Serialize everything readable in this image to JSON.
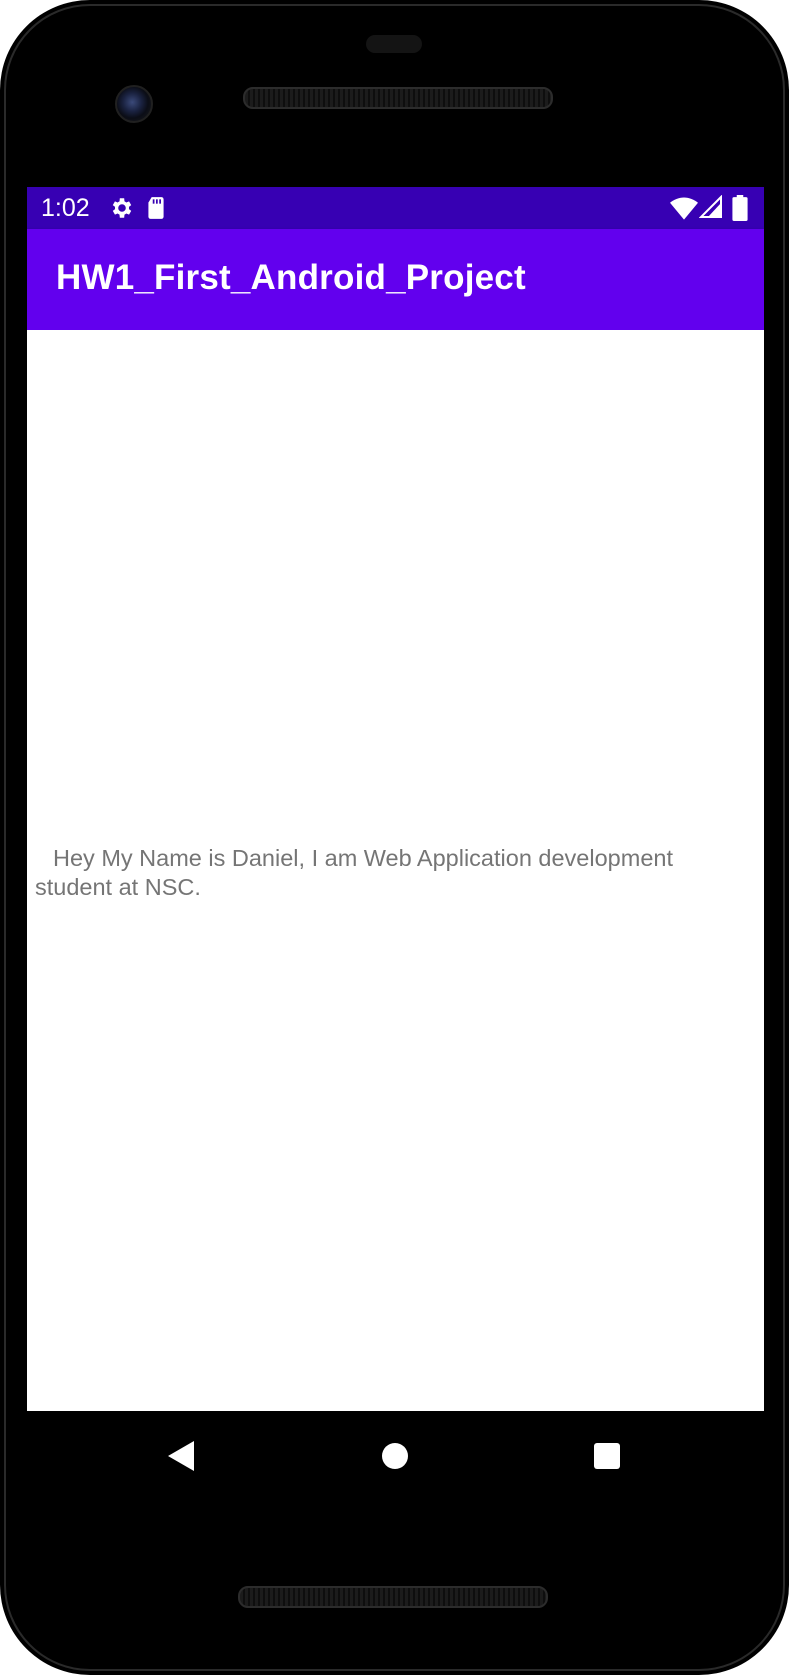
{
  "status_bar": {
    "time": "1:02",
    "icons": [
      "gear-icon",
      "sd-card-icon",
      "wifi-icon",
      "signal-icon",
      "battery-icon"
    ]
  },
  "app_bar": {
    "title": "HW1_First_Android_Project"
  },
  "content": {
    "message": "Hey My Name is Daniel, I am Web Application development student at NSC."
  },
  "navigation": {
    "buttons": [
      "back-icon",
      "home-icon",
      "recents-icon"
    ]
  },
  "colors": {
    "status_bar": "#3700b3",
    "app_bar": "#6200ee",
    "text": "#757575",
    "background": "#ffffff"
  }
}
